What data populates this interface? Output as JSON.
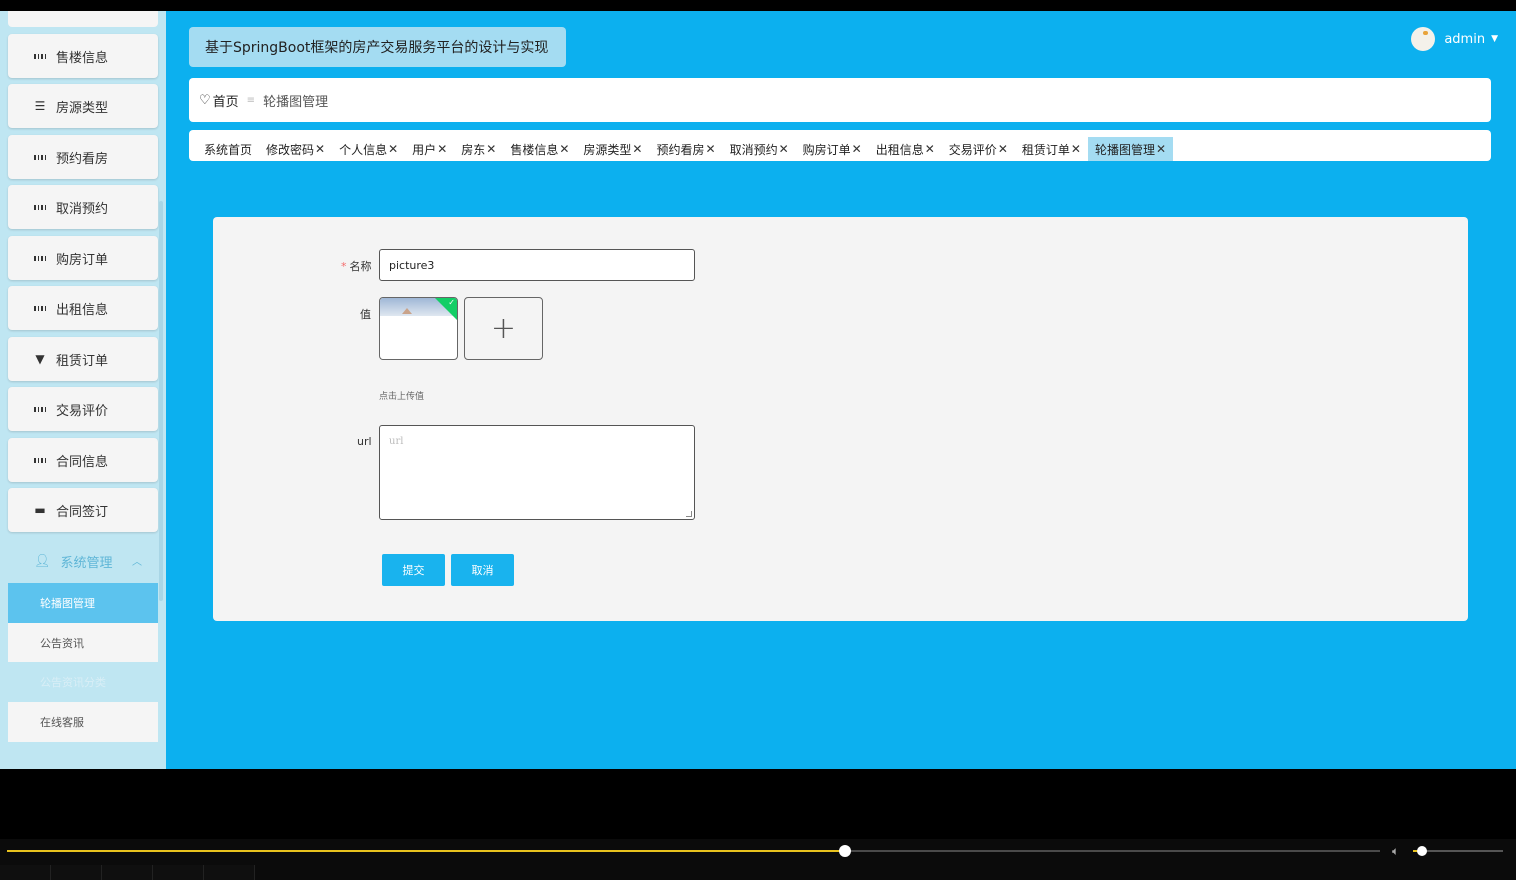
{
  "header": {
    "app_title": "基于SpringBoot框架的房产交易服务平台的设计与实现",
    "user_name": "admin"
  },
  "sidebar": {
    "items": [
      {
        "label": "售楼信息",
        "icon": "grid-icon"
      },
      {
        "label": "房源类型",
        "icon": "list-icon"
      },
      {
        "label": "预约看房",
        "icon": "grid-icon"
      },
      {
        "label": "取消预约",
        "icon": "grid-icon"
      },
      {
        "label": "购房订单",
        "icon": "grid-icon"
      },
      {
        "label": "出租信息",
        "icon": "grid-icon"
      },
      {
        "label": "租赁订单",
        "icon": "trophy-icon"
      },
      {
        "label": "交易评价",
        "icon": "grid-icon"
      },
      {
        "label": "合同信息",
        "icon": "grid-icon"
      },
      {
        "label": "合同签订",
        "icon": "printer-icon"
      }
    ],
    "system_group": {
      "label": "系统管理",
      "icon": "user-icon",
      "children": [
        "轮播图管理",
        "公告资讯",
        "公告资讯分类",
        "在线客服"
      ]
    }
  },
  "breadcrumb": {
    "home": "首页",
    "current": "轮播图管理"
  },
  "tabs": [
    {
      "label": "系统首页",
      "closable": false
    },
    {
      "label": "修改密码",
      "closable": true
    },
    {
      "label": "个人信息",
      "closable": true
    },
    {
      "label": "用户",
      "closable": true
    },
    {
      "label": "房东",
      "closable": true
    },
    {
      "label": "售楼信息",
      "closable": true
    },
    {
      "label": "房源类型",
      "closable": true
    },
    {
      "label": "预约看房",
      "closable": true
    },
    {
      "label": "取消预约",
      "closable": true
    },
    {
      "label": "购房订单",
      "closable": true
    },
    {
      "label": "出租信息",
      "closable": true
    },
    {
      "label": "交易评价",
      "closable": true
    },
    {
      "label": "租赁订单",
      "closable": true
    },
    {
      "label": "轮播图管理",
      "closable": true,
      "active": true
    }
  ],
  "form": {
    "name_label": "名称",
    "name_value": "picture3",
    "value_label": "值",
    "upload_hint": "点击上传值",
    "url_label": "url",
    "url_placeholder": "url",
    "submit_label": "提交",
    "cancel_label": "取消"
  },
  "colors": {
    "main_bg": "#0cb0ef",
    "sidebar_bg": "#bfe6f2",
    "active_item": "#5cc3ee",
    "button": "#19b3ee",
    "progress": "#e8c21e"
  },
  "player": {
    "progress": 0.61,
    "volume": 0.1
  }
}
